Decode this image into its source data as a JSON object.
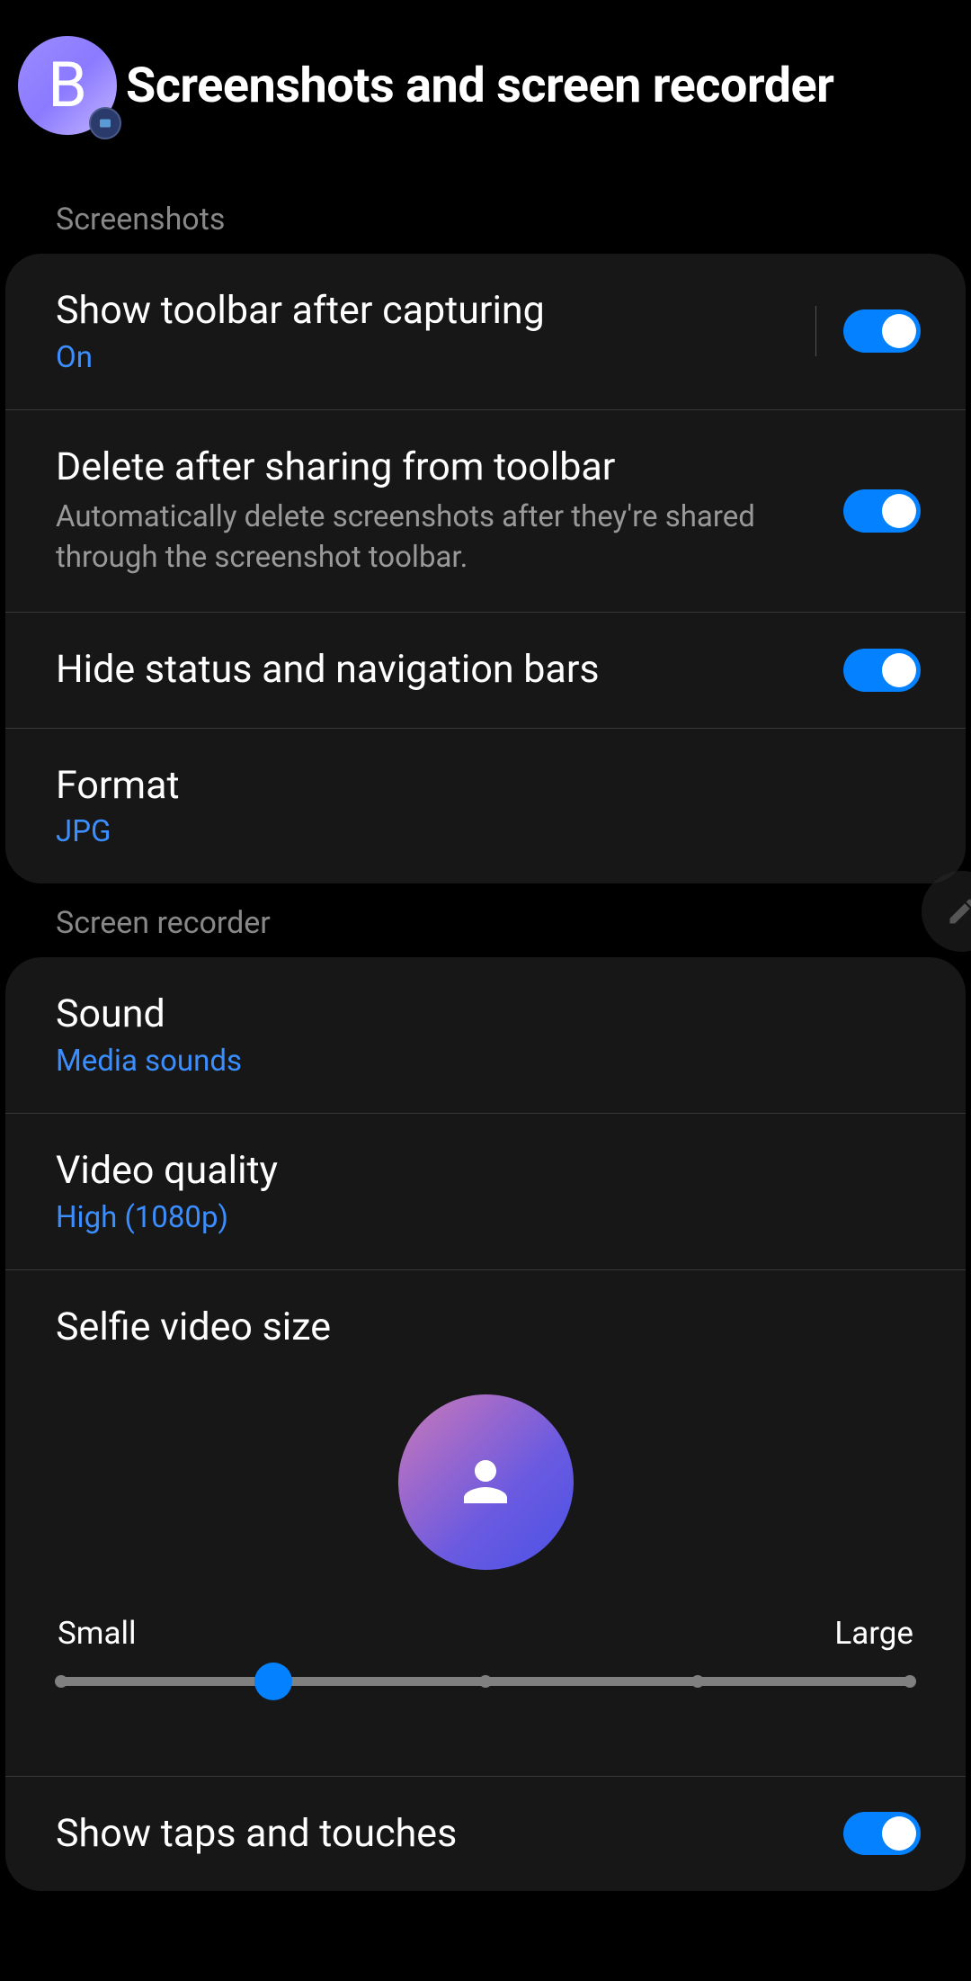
{
  "header": {
    "avatar_letter": "B",
    "title": "Screenshots and screen recorder"
  },
  "sections": {
    "screenshots": {
      "label": "Screenshots",
      "show_toolbar": {
        "title": "Show toolbar after capturing",
        "value": "On",
        "on": true
      },
      "delete_after_sharing": {
        "title": "Delete after sharing from toolbar",
        "desc": "Automatically delete screenshots after they're shared through the screenshot toolbar.",
        "on": true
      },
      "hide_bars": {
        "title": "Hide status and navigation bars",
        "on": true
      },
      "format": {
        "title": "Format",
        "value": "JPG"
      }
    },
    "recorder": {
      "label": "Screen recorder",
      "sound": {
        "title": "Sound",
        "value": "Media sounds"
      },
      "video_quality": {
        "title": "Video quality",
        "value": "High (1080p)"
      },
      "selfie_size": {
        "title": "Selfie video size",
        "min_label": "Small",
        "max_label": "Large",
        "value_percent": 25
      },
      "show_taps": {
        "title": "Show taps and touches",
        "on": true
      }
    }
  }
}
